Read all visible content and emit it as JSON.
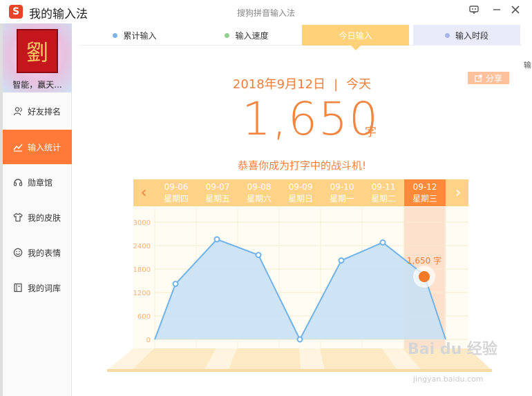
{
  "app": {
    "title": "我的输入法",
    "window_subtitle": "搜狗拼音输入法",
    "logo_letter": "S"
  },
  "titlebar_icons": [
    "feedback-icon",
    "minimize-icon",
    "close-icon"
  ],
  "user": {
    "avatar_glyph": "劉",
    "caption": "智能，赢天..."
  },
  "sidebar": {
    "items": [
      {
        "label": "好友排名",
        "icon": "friends-icon"
      },
      {
        "label": "输入统计",
        "icon": "chart-icon",
        "active": true
      },
      {
        "label": "勋章馆",
        "icon": "medal-icon"
      },
      {
        "label": "我的皮肤",
        "icon": "shirt-icon"
      },
      {
        "label": "我的表情",
        "icon": "smiley-icon"
      },
      {
        "label": "我的词库",
        "icon": "dictionary-icon"
      }
    ]
  },
  "tabs": [
    {
      "label": "累计输入",
      "dot": "#7fb2e5"
    },
    {
      "label": "输入速度",
      "dot": "#8fd18b"
    },
    {
      "label": "今日输入",
      "active": true
    },
    {
      "label": "输入时段",
      "dot": "#a7b2ea"
    }
  ],
  "summary": {
    "date": "2018年9月12日",
    "separator": "|",
    "relative_day": "今天",
    "count": "1,650",
    "unit": "字",
    "message": "恭喜你成为打字中的战斗机!",
    "share_label": "分享"
  },
  "days": [
    {
      "date": "09-06",
      "weekday": "星期四"
    },
    {
      "date": "09-07",
      "weekday": "星期五"
    },
    {
      "date": "09-08",
      "weekday": "星期六"
    },
    {
      "date": "09-09",
      "weekday": "星期日"
    },
    {
      "date": "09-10",
      "weekday": "星期一"
    },
    {
      "date": "09-11",
      "weekday": "星期二"
    },
    {
      "date": "09-12",
      "weekday": "星期三",
      "today": true
    }
  ],
  "chart_data": {
    "type": "area",
    "categories": [
      "09-06",
      "09-07",
      "09-08",
      "09-09",
      "09-10",
      "09-11",
      "09-12"
    ],
    "values": [
      1420,
      2560,
      2160,
      0,
      2020,
      2480,
      1650
    ],
    "y_ticks": [
      "0",
      "600",
      "1200",
      "1800",
      "2400",
      "3000"
    ],
    "ylim": [
      0,
      3000
    ],
    "highlight_label": "1,650 字",
    "colors": {
      "fill": "#c9e1f4",
      "line": "#6fb3e8",
      "highlight": "#f47a27",
      "axis_text": "#f4b07a"
    }
  },
  "watermark": {
    "text": "Bai du 经验",
    "sub": "jingyan.baidu.com"
  },
  "right_edge_text": "输"
}
